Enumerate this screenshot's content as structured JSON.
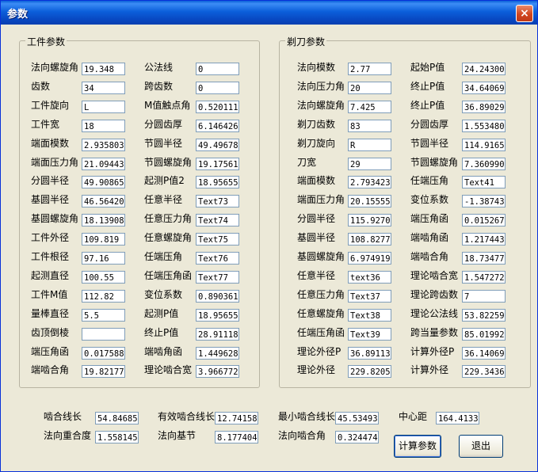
{
  "window": {
    "title": "参数",
    "close_glyph": "×"
  },
  "groups": {
    "workpiece": "工件参数",
    "shaver": "剃刀参数"
  },
  "col1": [
    {
      "label": "法向螺旋角",
      "value": "19.348"
    },
    {
      "label": "齿数",
      "value": "34"
    },
    {
      "label": "工件旋向",
      "value": "L"
    },
    {
      "label": "工件宽",
      "value": "18"
    },
    {
      "label": "端面模数",
      "value": "2.9358032"
    },
    {
      "label": "端面压力角",
      "value": "21.094435"
    },
    {
      "label": "分圆半径",
      "value": "49.908654"
    },
    {
      "label": "基圆半径",
      "value": "46.564200"
    },
    {
      "label": "基圆螺旋角",
      "value": "18.139088"
    },
    {
      "label": "工件外径",
      "value": "109.819"
    },
    {
      "label": "工件根径",
      "value": "97.16"
    },
    {
      "label": "起测直径",
      "value": "100.55"
    },
    {
      "label": "工件M值",
      "value": "112.82"
    },
    {
      "label": "量棒直径",
      "value": "5.5"
    },
    {
      "label": "齿顶倒棱",
      "value": ""
    },
    {
      "label": "端压角函",
      "value": "0.0175889"
    },
    {
      "label": "端啮合角",
      "value": "19.821776"
    }
  ],
  "col2": [
    {
      "label": "公法线",
      "value": "0"
    },
    {
      "label": "跨齿数",
      "value": "0"
    },
    {
      "label": "M值触点角",
      "value": "0.5201116"
    },
    {
      "label": "分圆齿厚",
      "value": "6.1464265"
    },
    {
      "label": "节圆半径",
      "value": "49.496788"
    },
    {
      "label": "节圆螺旋角",
      "value": "19.175612"
    },
    {
      "label": "起测P值2",
      "value": "18.956551"
    },
    {
      "label": "任意半径",
      "value": "Text73"
    },
    {
      "label": "任意压力角",
      "value": "Text74"
    },
    {
      "label": "任意螺旋角",
      "value": "Text75"
    },
    {
      "label": "任端压角",
      "value": "Text76"
    },
    {
      "label": "任端压角函",
      "value": "Text77"
    },
    {
      "label": "变位系数",
      "value": "0.8903615"
    },
    {
      "label": "起测P值",
      "value": "18.956551"
    },
    {
      "label": "终止P值",
      "value": "28.911183"
    },
    {
      "label": "端啮角函",
      "value": "1.4496283"
    },
    {
      "label": "理论啮合宽",
      "value": "3.9667721"
    }
  ],
  "col3": [
    {
      "label": "法向模数",
      "value": "2.77"
    },
    {
      "label": "法向压力角",
      "value": "20"
    },
    {
      "label": "法向螺旋角",
      "value": "7.425"
    },
    {
      "label": "剃刀齿数",
      "value": "83"
    },
    {
      "label": "剃刀旋向",
      "value": "R"
    },
    {
      "label": "刀宽",
      "value": "29"
    },
    {
      "label": "端面模数",
      "value": "2.7934232"
    },
    {
      "label": "端面压力角",
      "value": "20.155559"
    },
    {
      "label": "分圆半径",
      "value": "115.92706"
    },
    {
      "label": "基圆半径",
      "value": "108.82775"
    },
    {
      "label": "基圆螺旋角",
      "value": "6.9749198"
    },
    {
      "label": "任意半径",
      "value": "text36"
    },
    {
      "label": "任意压力角",
      "value": "Text37"
    },
    {
      "label": "任意螺旋角",
      "value": "Text38"
    },
    {
      "label": "任端压角函",
      "value": "Text39"
    },
    {
      "label": "理论外径P",
      "value": "36.891139"
    },
    {
      "label": "理论外径",
      "value": "229.82057"
    }
  ],
  "col4": [
    {
      "label": "起始P值",
      "value": "24.243003"
    },
    {
      "label": "终止P值",
      "value": "34.640693"
    },
    {
      "label": "终止P值",
      "value": "36.890295"
    },
    {
      "label": "分圆齿厚",
      "value": "1.5534804"
    },
    {
      "label": "节圆半径",
      "value": "114.91654"
    },
    {
      "label": "节圆螺旋角",
      "value": "7.3609906"
    },
    {
      "label": "任端压角",
      "value": "Text41"
    },
    {
      "label": "变位系数",
      "value": "-1.387439"
    },
    {
      "label": "端压角函",
      "value": "0.0152671"
    },
    {
      "label": "端啮角函",
      "value": "1.2174430"
    },
    {
      "label": "端啮合角",
      "value": "18.734774"
    },
    {
      "label": "理论啮合宽",
      "value": "1.5472728"
    },
    {
      "label": "理论跨齿数",
      "value": "7"
    },
    {
      "label": "理论公法线",
      "value": "53.822595"
    },
    {
      "label": "跨当量参数",
      "value": "85.019926"
    },
    {
      "label": "计算外径P",
      "value": "36.140693"
    },
    {
      "label": "计算外径",
      "value": "229.34367"
    }
  ],
  "bottom": [
    {
      "label": "啮合线长",
      "value": "54.846857"
    },
    {
      "label": "有效啮合线长",
      "value": "12.741586"
    },
    {
      "label": "最小啮合线长",
      "value": "45.534939"
    },
    {
      "label": "中心距",
      "value": "164.41333"
    },
    {
      "label": "法向重合度",
      "value": "1.5581456"
    },
    {
      "label": "法向基节",
      "value": "8.1774040"
    },
    {
      "label": "法向啮合角",
      "value": "0.3244745"
    }
  ],
  "buttons": {
    "calc": "计算参数",
    "exit": "退出"
  }
}
